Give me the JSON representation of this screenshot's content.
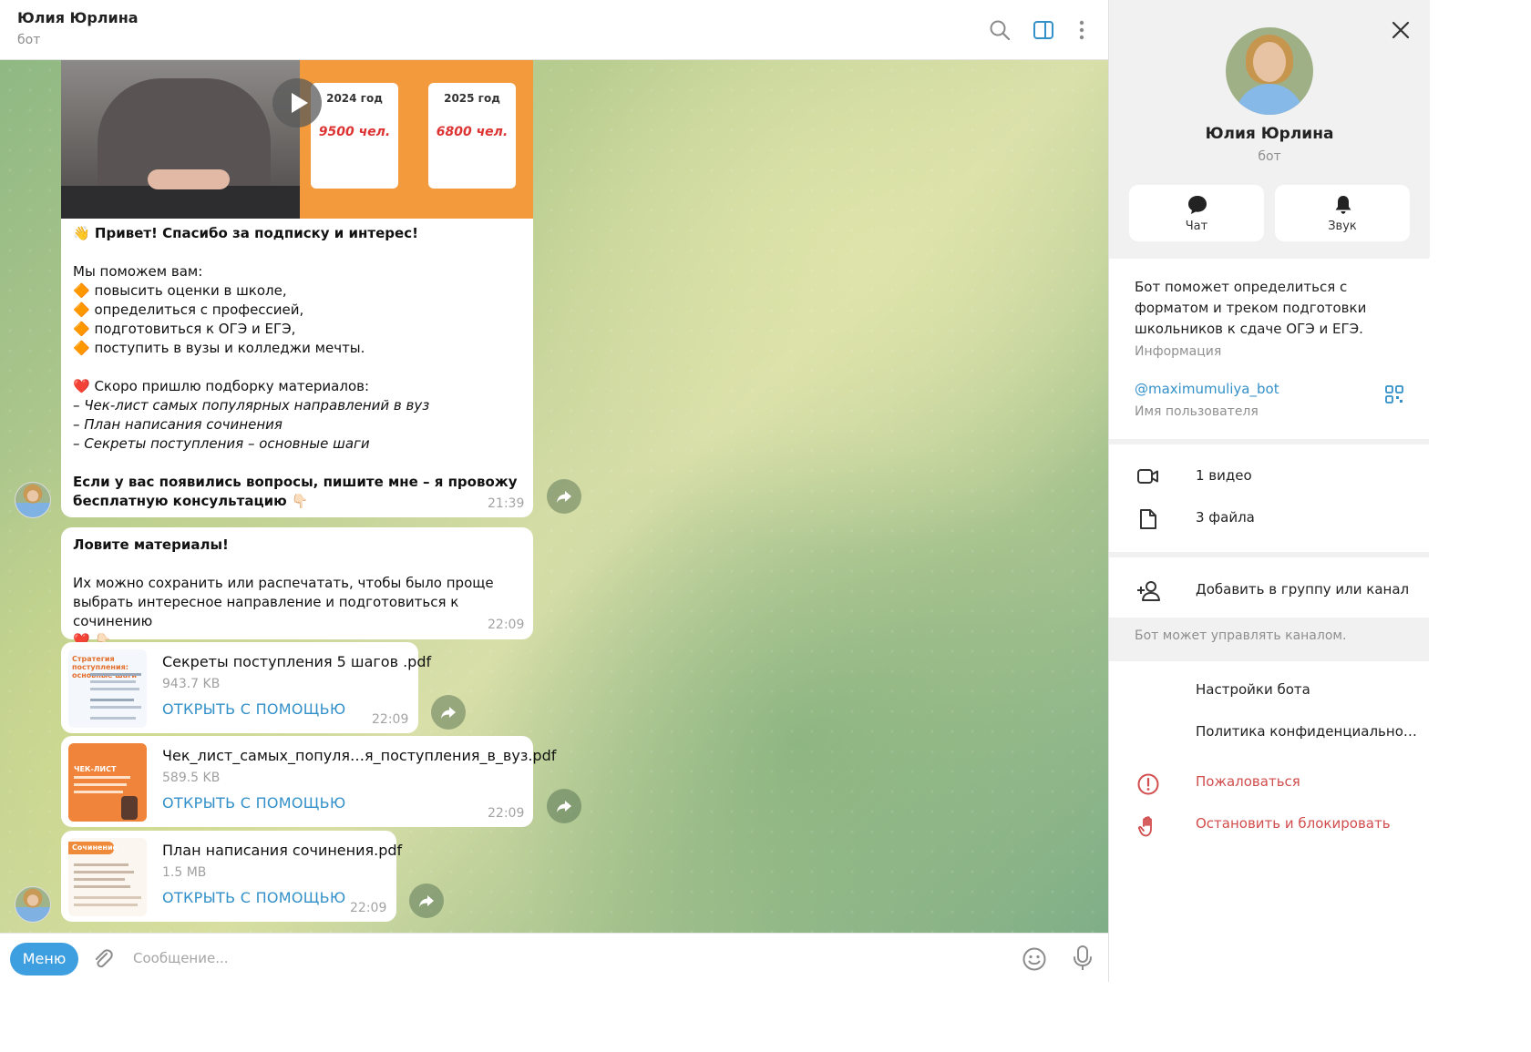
{
  "header": {
    "title": "Юлия Юрлина",
    "subtitle": "бот"
  },
  "video_preview": {
    "year1": "2024 год",
    "count1": "9500 чел.",
    "year2": "2025 год",
    "count2": "6800 чел."
  },
  "messages": [
    {
      "lines": [
        "👋 Привет! Спасибо за подписку и интерес!",
        "",
        "Мы поможем вам:",
        "🔶 повысить оценки в школе,",
        "🔶 определиться с профессией,",
        "🔶 подготовиться к ОГЭ и ЕГЭ,",
        "🔶 поступить в вузы и колледжи мечты.",
        "",
        "❤️ Скоро пришлю подборку материалов:",
        "– Чек-лист самых популярных направлений в вуз",
        "– План написания сочинения",
        "– Секреты поступления – основные шаги",
        "",
        "Если у вас появились вопросы, пишите мне – я провожу",
        "бесплатную консультацию 👇🏻"
      ],
      "time": "21:39"
    },
    {
      "lines": [
        "Ловите материалы!",
        "",
        "Их можно сохранить или распечатать, чтобы было проще",
        "выбрать интересное направление и подготовиться к сочинению",
        "❤️ 👇🏻"
      ],
      "time": "22:09"
    }
  ],
  "files": [
    {
      "name": "Секреты поступления 5 шагов .pdf",
      "size": "943.7 KB",
      "open": "ОТКРЫТЬ С ПОМОЩЬЮ",
      "time": "22:09",
      "thumb_title": "Стратегия поступления: основные шаги"
    },
    {
      "name": "Чек_лист_самых_популя…я_поступления_в_вуз.pdf",
      "size": "589.5 KB",
      "open": "ОТКРЫТЬ С ПОМОЩЬЮ",
      "time": "22:09",
      "thumb_title": "ЧЕК-ЛИСТ"
    },
    {
      "name": "План написания сочинения.pdf",
      "size": "1.5 MB",
      "open": "ОТКРЫТЬ С ПОМОЩЬЮ",
      "time": "22:09",
      "thumb_title": "Сочинение"
    }
  ],
  "composer": {
    "menu_label": "Меню",
    "placeholder": "Сообщение..."
  },
  "panel": {
    "name": "Юлия Юрлина",
    "role": "бот",
    "actions": [
      {
        "label": "Чат",
        "icon": "chat-icon"
      },
      {
        "label": "Звук",
        "icon": "bell-icon"
      }
    ],
    "info_text": "Бот поможет определиться с форматом и треком подготовки школьников к сдаче ОГЭ и ЕГЭ.",
    "info_label": "Информация",
    "username": "@maximumuliya_bot",
    "username_label": "Имя пользователя",
    "media_rows": [
      {
        "label": "1 видео",
        "icon": "video-icon"
      },
      {
        "label": "3 файла",
        "icon": "file-icon"
      }
    ],
    "add_to_group": "Добавить в группу или канал",
    "note": "Бот может управлять каналом.",
    "bot_rows": [
      "Настройки бота",
      "Политика конфиденциальност..."
    ],
    "report": "Пожаловаться",
    "block": "Остановить и блокировать"
  },
  "colors": {
    "accent": "#3390c8",
    "menu_button": "#3d9ee0",
    "danger": "#d24d4d"
  }
}
